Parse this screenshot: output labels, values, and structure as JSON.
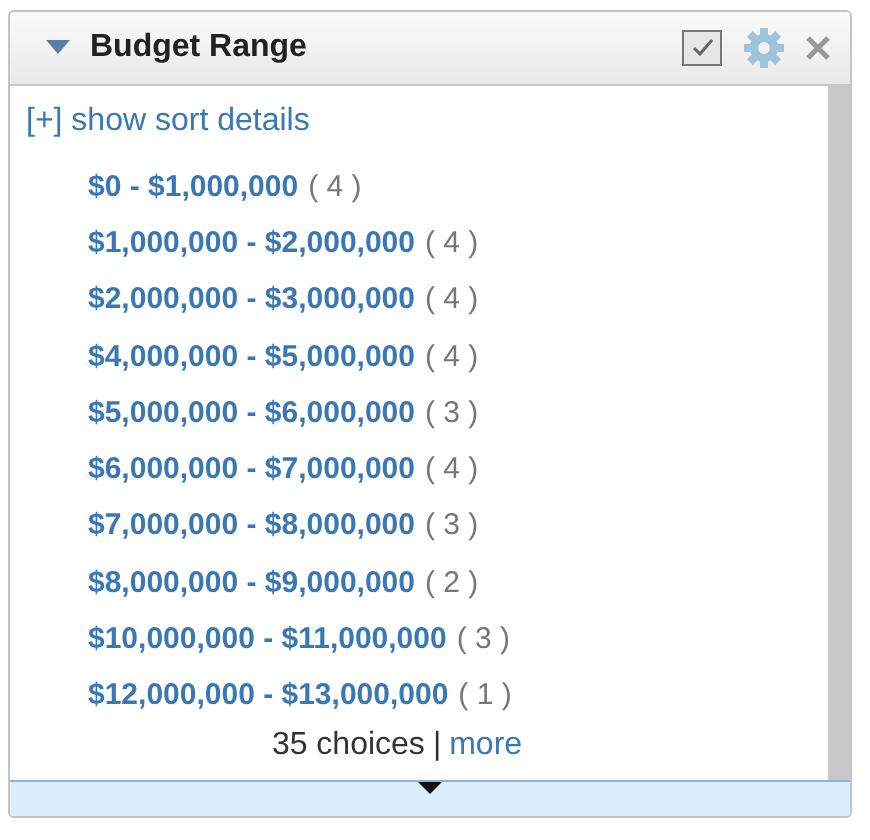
{
  "panel": {
    "title": "Budget Range",
    "expanded": true
  },
  "sort_link": "[+] show sort details",
  "choices": [
    {
      "label": "$0 - $1,000,000",
      "count": "( 4 )"
    },
    {
      "label": "$1,000,000 - $2,000,000",
      "count": "( 4 )"
    },
    {
      "label": "$2,000,000 - $3,000,000",
      "count": "( 4 )"
    },
    {
      "label": "$4,000,000 - $5,000,000",
      "count": "( 4 )"
    },
    {
      "label": "$5,000,000 - $6,000,000",
      "count": "( 3 )"
    },
    {
      "label": "$6,000,000 - $7,000,000",
      "count": "( 4 )"
    },
    {
      "label": "$7,000,000 - $8,000,000",
      "count": "( 3 )"
    },
    {
      "label": "$8,000,000 - $9,000,000",
      "count": "( 2 )"
    },
    {
      "label": "$10,000,000 - $11,000,000",
      "count": "( 3 )"
    },
    {
      "label": "$12,000,000 - $13,000,000",
      "count": "( 1 )"
    }
  ],
  "footer": {
    "total": "35 choices",
    "separator": "|",
    "more": "more"
  }
}
